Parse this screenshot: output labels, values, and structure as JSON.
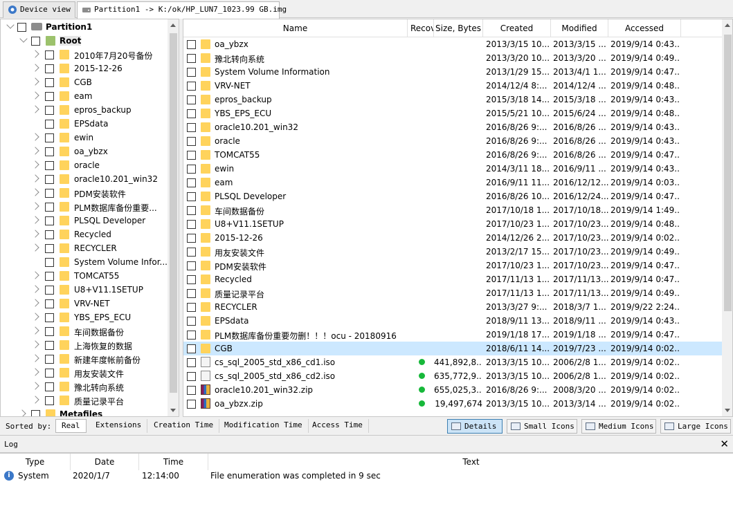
{
  "tabs": [
    {
      "label": "Device view",
      "active": false
    },
    {
      "label": "Partition1 -> K:/ok/HP_LUN7_1023.99 GB.img",
      "active": true
    }
  ],
  "tree": {
    "root_partition": "Partition1",
    "root": "Root",
    "items": [
      "2010年7月20号备份",
      "2015-12-26",
      "CGB",
      "eam",
      "epros_backup",
      "EPSdata",
      "ewin",
      "oa_ybzx",
      "oracle",
      "oracle10.201_win32",
      "PDM安装软件",
      "PLM数据库备份重要...",
      "PLSQL Developer",
      "Recycled",
      "RECYCLER",
      "System Volume Infor...",
      "TOMCAT55",
      "U8+V11.1SETUP",
      "VRV-NET",
      "YBS_EPS_ECU",
      "车间数据备份",
      "上海恢复的数据",
      "新建年度帐前备份",
      "用友安装文件",
      "豫北转向系统",
      "质量记录平台"
    ],
    "metafiles": "Metafiles"
  },
  "list": {
    "columns": [
      "Name",
      "Recov",
      "Size, Bytes",
      "Created",
      "Modified",
      "Accessed"
    ],
    "rows": [
      {
        "name": "oa_ybzx",
        "type": "folder",
        "size": "",
        "created": "2013/3/15 10...",
        "modified": "2013/3/15 ...",
        "accessed": "2019/9/14 0:43..."
      },
      {
        "name": "豫北转向系统",
        "type": "folder",
        "size": "",
        "created": "2013/3/20 10...",
        "modified": "2013/3/20 ...",
        "accessed": "2019/9/14 0:49..."
      },
      {
        "name": "System Volume Information",
        "type": "folder",
        "size": "",
        "created": "2013/1/29 15...",
        "modified": "2013/4/1 1...",
        "accessed": "2019/9/14 0:47..."
      },
      {
        "name": "VRV-NET",
        "type": "folder",
        "size": "",
        "created": "2014/12/4 8:...",
        "modified": "2014/12/4 ...",
        "accessed": "2019/9/14 0:48..."
      },
      {
        "name": "epros_backup",
        "type": "folder",
        "size": "",
        "created": "2015/3/18 14...",
        "modified": "2015/3/18 ...",
        "accessed": "2019/9/14 0:43..."
      },
      {
        "name": "YBS_EPS_ECU",
        "type": "folder",
        "size": "",
        "created": "2015/5/21 10...",
        "modified": "2015/6/24 ...",
        "accessed": "2019/9/14 0:48..."
      },
      {
        "name": "oracle10.201_win32",
        "type": "folder",
        "size": "",
        "created": "2016/8/26 9:...",
        "modified": "2016/8/26 ...",
        "accessed": "2019/9/14 0:43..."
      },
      {
        "name": "oracle",
        "type": "folder",
        "size": "",
        "created": "2016/8/26 9:...",
        "modified": "2016/8/26 ...",
        "accessed": "2019/9/14 0:43..."
      },
      {
        "name": "TOMCAT55",
        "type": "folder",
        "size": "",
        "created": "2016/8/26 9:...",
        "modified": "2016/8/26 ...",
        "accessed": "2019/9/14 0:47..."
      },
      {
        "name": "ewin",
        "type": "folder",
        "size": "",
        "created": "2014/3/11 18...",
        "modified": "2016/9/11 ...",
        "accessed": "2019/9/14 0:43..."
      },
      {
        "name": "eam",
        "type": "folder",
        "size": "",
        "created": "2016/9/11 11...",
        "modified": "2016/12/12...",
        "accessed": "2019/9/14 0:03..."
      },
      {
        "name": "PLSQL Developer",
        "type": "folder",
        "size": "",
        "created": "2016/8/26 10...",
        "modified": "2016/12/24...",
        "accessed": "2019/9/14 0:47..."
      },
      {
        "name": "车间数据备份",
        "type": "folder",
        "size": "",
        "created": "2017/10/18 1...",
        "modified": "2017/10/18...",
        "accessed": "2019/9/14 1:49..."
      },
      {
        "name": "U8+V11.1SETUP",
        "type": "folder",
        "size": "",
        "created": "2017/10/23 1...",
        "modified": "2017/10/23...",
        "accessed": "2019/9/14 0:48..."
      },
      {
        "name": "2015-12-26",
        "type": "folder",
        "size": "",
        "created": "2014/12/26 2...",
        "modified": "2017/10/23...",
        "accessed": "2019/9/14 0:02..."
      },
      {
        "name": "用友安装文件",
        "type": "folder",
        "size": "",
        "created": "2013/2/17 15...",
        "modified": "2017/10/23...",
        "accessed": "2019/9/14 0:49..."
      },
      {
        "name": "PDM安装软件",
        "type": "folder",
        "size": "",
        "created": "2017/10/23 1...",
        "modified": "2017/10/23...",
        "accessed": "2019/9/14 0:47..."
      },
      {
        "name": "Recycled",
        "type": "folder",
        "size": "",
        "created": "2017/11/13 1...",
        "modified": "2017/11/13...",
        "accessed": "2019/9/14 0:47..."
      },
      {
        "name": "质量记录平台",
        "type": "folder",
        "size": "",
        "created": "2017/11/13 1...",
        "modified": "2017/11/13...",
        "accessed": "2019/9/14 0:49..."
      },
      {
        "name": "RECYCLER",
        "type": "folder",
        "size": "",
        "created": "2013/3/27 9:...",
        "modified": "2018/3/7 1...",
        "accessed": "2019/9/22 2:24..."
      },
      {
        "name": "EPSdata",
        "type": "folder",
        "size": "",
        "created": "2018/9/11 13...",
        "modified": "2018/9/11 ...",
        "accessed": "2019/9/14 0:43..."
      },
      {
        "name": "PLM数据库备份重要勿删！！！ocu - 20180916",
        "type": "folder",
        "size": "",
        "created": "2019/1/18 17...",
        "modified": "2019/1/18 ...",
        "accessed": "2019/9/14 0:47..."
      },
      {
        "name": "CGB",
        "type": "folder",
        "size": "",
        "created": "2018/6/11 14...",
        "modified": "2019/7/23 ...",
        "accessed": "2019/9/14 0:02...",
        "selected": true
      },
      {
        "name": "cs_sql_2005_std_x86_cd1.iso",
        "type": "file",
        "recov": true,
        "size": "441,892,8...",
        "created": "2013/3/15 10...",
        "modified": "2006/2/8 1...",
        "accessed": "2019/9/14 0:02..."
      },
      {
        "name": "cs_sql_2005_std_x86_cd2.iso",
        "type": "file",
        "recov": true,
        "size": "635,772,9...",
        "created": "2013/3/15 10...",
        "modified": "2006/2/8 1...",
        "accessed": "2019/9/14 0:02..."
      },
      {
        "name": "oracle10.201_win32.zip",
        "type": "zip",
        "recov": true,
        "size": "655,025,3...",
        "created": "2016/8/26 9:...",
        "modified": "2008/3/20 ...",
        "accessed": "2019/9/14 0:02..."
      },
      {
        "name": "oa_ybzx.zip",
        "type": "zip",
        "recov": true,
        "size": "19,497,674",
        "created": "2013/3/15 10...",
        "modified": "2013/3/14 ...",
        "accessed": "2019/9/14 0:02..."
      }
    ]
  },
  "sortbar": {
    "label": "Sorted by:",
    "tabs": [
      "Real",
      "Extensions",
      "Creation Time",
      "Modification Time",
      "Access Time"
    ],
    "views": [
      "Details",
      "Small Icons",
      "Medium Icons",
      "Large Icons"
    ]
  },
  "log": {
    "title": "Log",
    "close": "✕",
    "columns": [
      "Type",
      "Date",
      "Time",
      "Text"
    ],
    "rows": [
      {
        "type": "System",
        "date": "2020/1/7",
        "time": "12:14:00",
        "text": "File enumeration was completed in 9 sec"
      }
    ]
  }
}
